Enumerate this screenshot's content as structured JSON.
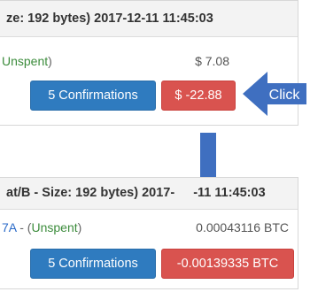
{
  "top_panel": {
    "header": "ze: 192 bytes) 2017-12-11 11:45:03",
    "status_text": "Unspent",
    "status_suffix": ")",
    "amount": "$ 7.08",
    "confirmations_label": "5 Confirmations",
    "value_label": "$ -22.88"
  },
  "click_arrow": {
    "label": "Click"
  },
  "bottom_panel": {
    "header_left": "at/B - Size: 192 bytes) 2017-",
    "header_right": "-11 11:45:03",
    "address_fragment": "7A",
    "separator": " - (",
    "status_text": "Unspent",
    "status_suffix": ")",
    "amount": "0.00043116 BTC",
    "confirmations_label": "5 Confirmations",
    "value_label": "-0.00139335 BTC"
  },
  "colors": {
    "blue_button": "#2f7bbf",
    "red_button": "#d9534f",
    "arrow": "#3f6fc0",
    "unspent_green": "#3c8c3c",
    "address_blue": "#2a6ac8"
  },
  "icons": [
    "arrow-left-icon",
    "arrow-down-icon"
  ]
}
